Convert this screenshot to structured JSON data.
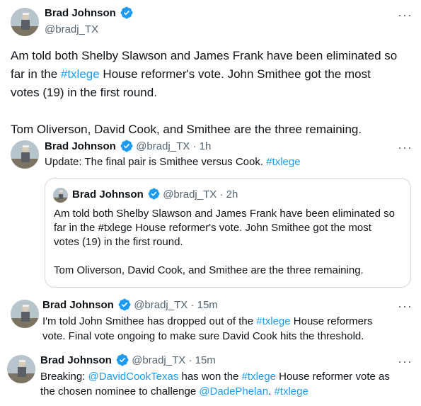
{
  "main_tweet": {
    "name": "Brad Johnson",
    "handle": "@bradj_TX",
    "more": "···",
    "lines": [
      [
        "Am told both Shelby Slawson and James Frank have been eliminated so"
      ],
      [
        "far in the ",
        {
          "tag": "#txlege"
        },
        " House reformer's vote. John Smithee got the most"
      ],
      [
        "votes (19) in the first round."
      ],
      [
        ""
      ],
      [
        "Tom Oliverson, David Cook, and Smithee are the three remaining."
      ]
    ]
  },
  "reply1": {
    "name": "Brad Johnson",
    "handle": "@bradj_TX",
    "sep": "·",
    "time": "1h",
    "more": "···",
    "text_prefix": "Update: The final pair is Smithee versus Cook. ",
    "text_tag": "#txlege"
  },
  "quote": {
    "name": "Brad Johnson",
    "handle": "@bradj_TX",
    "sep": "·",
    "time": "2h",
    "lines": [
      "Am told both Shelby Slawson and James Frank have been eliminated so",
      "far in the #txlege House reformer's vote. John Smithee got the most",
      "votes (19) in the first round.",
      "",
      "Tom Oliverson, David Cook, and Smithee are the three remaining."
    ]
  },
  "reply2": {
    "name": "Brad Johnson",
    "handle": "@bradj_TX",
    "sep": "·",
    "time": "15m",
    "more": "···",
    "line1_prefix": "I'm told John Smithee has dropped out of the ",
    "line1_tag": "#txlege",
    "line1_suffix": " House reformers",
    "line2": "vote. Final vote ongoing to make sure David Cook hits the threshold."
  },
  "reply3": {
    "name": "Brad Johnson",
    "handle": "@bradj_TX",
    "sep": "·",
    "time": "15m",
    "more": "···",
    "line1_a": "Breaking: ",
    "line1_mention": "@DavidCookTexas",
    "line1_b": " has won the ",
    "line1_tag": "#txlege",
    "line1_c": " House reformer vote as",
    "line2_a": "the chosen nominee to challenge ",
    "line2_mention": "@DadePhelan",
    "line2_b": ". ",
    "line2_tag": "#txlege"
  },
  "colors": {
    "link": "#1d9bf0",
    "muted": "#536471",
    "text": "#0f1419",
    "verified": "#1d9bf0",
    "border": "#cfd9de"
  },
  "icons": [
    "avatar-photo",
    "verified-badge-icon",
    "more-options-icon"
  ]
}
